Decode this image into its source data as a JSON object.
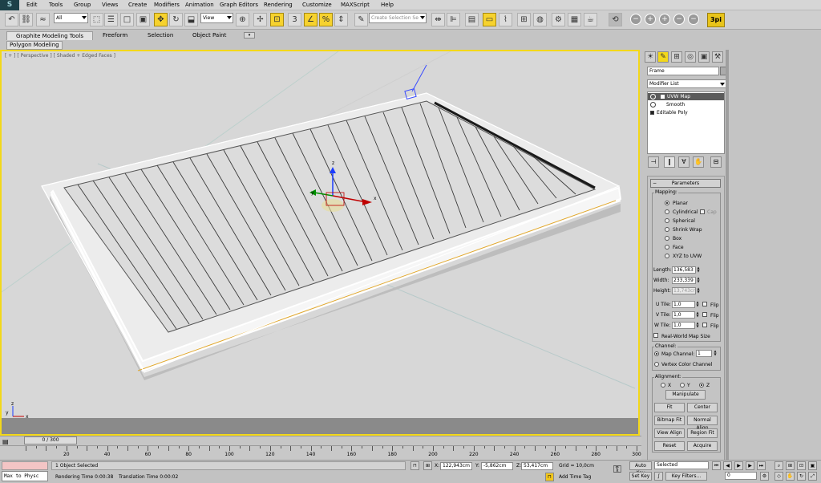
{
  "menu": {
    "logo": "S",
    "items": [
      "Edit",
      "Tools",
      "Group",
      "Views",
      "Create",
      "Modifiers",
      "Animation",
      "Graph Editors",
      "Rendering",
      "Customize",
      "MAXScript",
      "Help"
    ]
  },
  "toolbar": {
    "filter_value": "All",
    "refcoord_value": "View",
    "selection_set_placeholder": "Create Selection Se",
    "plugin_label": "3pi"
  },
  "ribbon": {
    "tabs": [
      "Graphite Modeling Tools",
      "Freeform",
      "Selection",
      "Object Paint"
    ],
    "panel_label": "Polygon Modeling"
  },
  "viewport": {
    "label": "[ + ] [ Perspective ] [ Shaded + Edged Faces ]",
    "gizmo_axes": {
      "x": "x",
      "y": "y",
      "z": "z"
    },
    "corner_axes": {
      "x": "x",
      "y": "y",
      "z": "z"
    }
  },
  "command_panel": {
    "object_name": "Frame",
    "modifier_list": "Modifier List",
    "stack": [
      {
        "label": "UVW Map",
        "selected": true
      },
      {
        "label": "Smooth",
        "selected": false
      },
      {
        "label": "Editable Poly",
        "selected": false
      }
    ],
    "parameters": {
      "title": "Parameters",
      "mapping_label": "Mapping:",
      "mapping_options": [
        "Planar",
        "Cylindrical",
        "Spherical",
        "Shrink Wrap",
        "Box",
        "Face",
        "XYZ to UVW"
      ],
      "mapping_selected": "Planar",
      "cap_label": "Cap",
      "length_label": "Length:",
      "length_value": "136,583",
      "width_label": "Width:",
      "width_value": "233,339",
      "height_label": "Height:",
      "height_value": "13,743cr",
      "utile_label": "U Tile:",
      "utile_value": "1,0",
      "vtile_label": "V Tile:",
      "vtile_value": "1,0",
      "wtile_label": "W Tile:",
      "wtile_value": "1,0",
      "flip_label": "Flip",
      "realworld_label": "Real-World Map Size",
      "channel_label": "Channel:",
      "map_channel_label": "Map Channel:",
      "map_channel_value": "1",
      "vertex_color_label": "Vertex Color Channel",
      "alignment_label": "Alignment:",
      "align_x": "X",
      "align_y": "Y",
      "align_z": "Z",
      "align_selected": "Z",
      "buttons": [
        "Manipulate",
        "Fit",
        "Center",
        "Bitmap Fit",
        "Normal Align",
        "View Align",
        "Region Fit",
        "Reset",
        "Acquire"
      ]
    }
  },
  "timeline": {
    "frame_display": "0 / 300",
    "ticks": [
      0,
      20,
      40,
      60,
      80,
      100,
      120,
      140,
      160,
      180,
      200,
      220,
      240,
      260,
      280,
      300
    ]
  },
  "status": {
    "maxscript_text": "Max to Physc",
    "selection_text": "1 Object Selected",
    "render_time_label": "Rendering Time  0:00:38",
    "translation_time_label": "Translation Time  0:00:02",
    "x_label": "X:",
    "x_value": "122,943cm",
    "y_label": "Y:",
    "y_value": "-5,862cm",
    "z_label": "Z:",
    "z_value": "53,417cm",
    "grid_text": "Grid = 10,0cm",
    "add_time_tag": "Add Time Tag",
    "auto_key": "Auto Key",
    "set_key": "Set Key",
    "key_mode_value": "Selected",
    "key_filters": "Key Filters...",
    "frame_value": "0"
  }
}
